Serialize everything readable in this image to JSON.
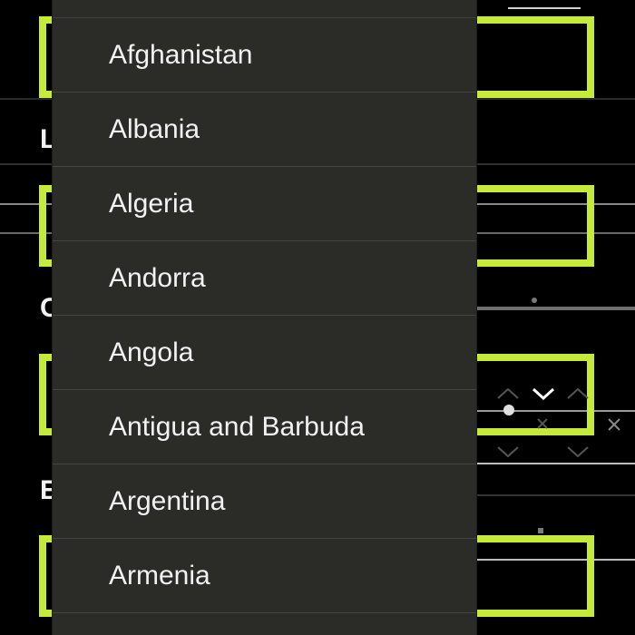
{
  "form": {
    "labels": [
      "L",
      "C",
      "E"
    ]
  },
  "dropdown": {
    "items": [
      "Afghanistan",
      "Albania",
      "Algeria",
      "Andorra",
      "Angola",
      "Antigua and Barbuda",
      "Argentina",
      "Armenia"
    ]
  },
  "colors": {
    "accent": "#c6ea3a",
    "dropdown_bg": "#2b2b28",
    "background": "#000000"
  }
}
